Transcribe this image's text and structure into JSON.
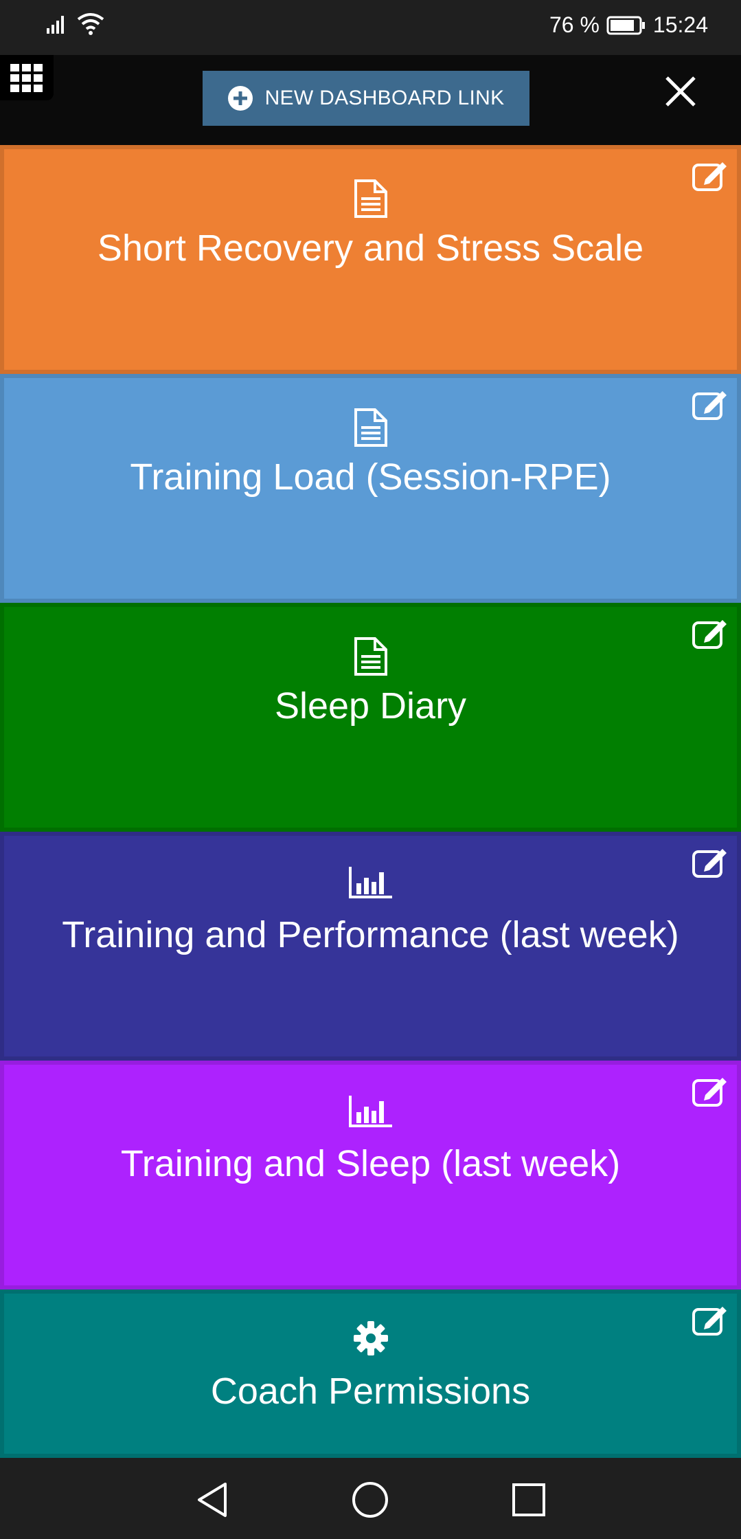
{
  "status_bar": {
    "battery_percent": "76 %",
    "time": "15:24",
    "icons": [
      "signal-icon",
      "wifi-icon",
      "battery-icon"
    ]
  },
  "top_bar": {
    "new_link_label": "NEW DASHBOARD LINK",
    "icons": [
      "grid-menu-icon",
      "plus-circle-icon",
      "close-icon"
    ]
  },
  "tiles": [
    {
      "label": "Short Recovery and Stress Scale",
      "icon": "document-icon",
      "color": "#ee8033"
    },
    {
      "label": "Training Load (Session-RPE)",
      "icon": "document-icon",
      "color": "#5b9bd5"
    },
    {
      "label": "Sleep Diary",
      "icon": "document-icon",
      "color": "#017f01"
    },
    {
      "label": "Training and Performance (last week)",
      "icon": "bar-chart-icon",
      "color": "#363499"
    },
    {
      "label": "Training and Sleep (last week)",
      "icon": "bar-chart-icon",
      "color": "#ad22fe"
    },
    {
      "label": "Coach Permissions",
      "icon": "gear-icon",
      "color": "#008080"
    }
  ],
  "nav_bar": {
    "icons": [
      "back-triangle-icon",
      "home-circle-icon",
      "recents-square-icon"
    ]
  }
}
